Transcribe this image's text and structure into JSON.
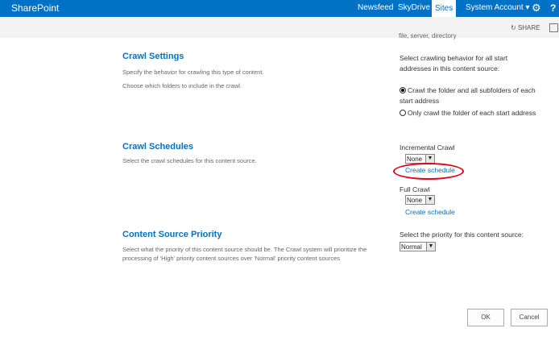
{
  "topbar": {
    "brand": "SharePoint",
    "newsfeed": "Newsfeed",
    "skydrive": "SkyDrive",
    "sites": "Sites",
    "account": "System Account",
    "account_chevron": "▾",
    "settings_glyph": "⚙",
    "help": "?"
  },
  "subbar": {
    "share": "SHARE"
  },
  "clipped_text": "file, server, directory",
  "crawl_settings": {
    "heading": "Crawl Settings",
    "desc1": "Specify the behavior for crawling this type of content.",
    "desc2": "Choose which folders to include in the crawl.",
    "prompt": "Select crawling behavior for all start addresses in this content source:",
    "option1": "Crawl the folder and all subfolders of each start address",
    "option2": "Only crawl the folder of each start address",
    "selected": "option1"
  },
  "crawl_schedules": {
    "heading": "Crawl Schedules",
    "desc": "Select the crawl schedules for this content source.",
    "incremental_label": "Incremental Crawl",
    "incremental_value": "None",
    "incremental_link": "Create schedule",
    "full_label": "Full Crawl",
    "full_value": "None",
    "full_link": "Create schedule"
  },
  "priority": {
    "heading": "Content Source Priority",
    "desc": "Select what the priority of this content source should be. The Crawl system will prioritize the processing of 'High' priority content sources over 'Normal' priority content sources",
    "prompt": "Select the priority for this content source:",
    "value": "Normal"
  },
  "buttons": {
    "ok": "OK",
    "cancel": "Cancel"
  },
  "colors": {
    "suite_bar": "#0072c6",
    "heading": "#0072c6",
    "highlight_ring": "#e0001b"
  },
  "icons": {
    "dropdown": "▼",
    "share": "↻"
  }
}
